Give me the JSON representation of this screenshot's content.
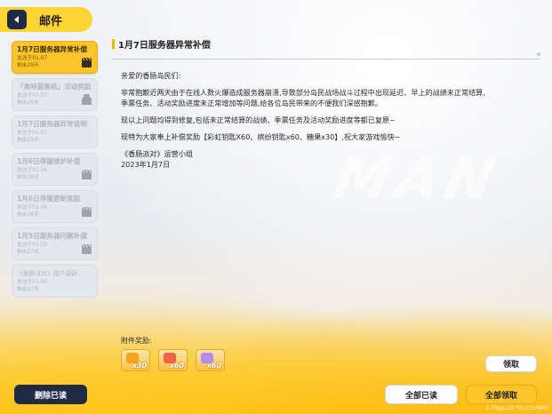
{
  "header": {
    "title": "邮件",
    "back_icon": "back-arrow-icon"
  },
  "sidebar": {
    "items": [
      {
        "title": "1月7日服务器异常补偿",
        "sent": "发送于01-07",
        "remaining": "剩余29天",
        "icon": "clapper-icon",
        "active": true
      },
      {
        "title": "「奥特曼集结」活动奖励",
        "sent": "发送于01-07",
        "remaining": "剩余29天",
        "icon": "gift-icon",
        "active": false
      },
      {
        "title": "1月7日服务器异常说明",
        "sent": "发送于01-07",
        "remaining": "剩余29天",
        "icon": "",
        "active": false
      },
      {
        "title": "1月6日停服维护补偿",
        "sent": "发送于01-06",
        "remaining": "剩余28天",
        "icon": "clapper-icon",
        "active": false
      },
      {
        "title": "1月6日停服更新奖励",
        "sent": "发送于01-06",
        "remaining": "剩余28天",
        "icon": "clapper-icon",
        "active": false
      },
      {
        "title": "1月5日服务器问题补偿",
        "sent": "发送于01-05",
        "remaining": "剩余27天",
        "icon": "clapper-icon",
        "active": false
      },
      {
        "title": "《香肠派对》用户调研...",
        "sent": "发送于01-05",
        "remaining": "剩余27天",
        "icon": "",
        "active": false
      }
    ]
  },
  "content": {
    "title": "1月7日服务器异常补偿",
    "greeting": "亲爱的香肠岛民们:",
    "paragraph1_line1": "非常抱歉近两天由于在线人数火爆造成服务器崩溃,导致部分岛民战场战斗过程中出现延迟、早上的战绩未正常结算,",
    "paragraph1_line2": "季票任务、活动奖励进度未正常增加等问题,给各位岛民带来的不便我们深感抱歉。",
    "paragraph2": "现以上问题均得到修复,包括未正常结算的战绩、季票任务及活动奖励进度等都已复原~",
    "paragraph3": "现特为大家奉上补偿奖励【彩虹钥匙X60、缤纷钥匙x60、糖果x30】,祝大家游戏愉快~",
    "signature": "《香肠派对》运营小组",
    "date": "2023年1月7日",
    "watermark": "MAN"
  },
  "attachments": {
    "label": "附件奖励:",
    "items": [
      {
        "name": "candy-icon",
        "qty": "x30",
        "color": "#f7a21b"
      },
      {
        "name": "rainbow-key-icon",
        "qty": "x60",
        "color": "#f0644a"
      },
      {
        "name": "colorful-key-icon",
        "qty": "x60",
        "color": "#b48cf0"
      }
    ]
  },
  "buttons": {
    "claim": "领取",
    "delete_read": "删除已读",
    "read_all": "全部已读",
    "claim_all": "全部领取"
  },
  "version": "1.79pjx.15.05-1154883"
}
